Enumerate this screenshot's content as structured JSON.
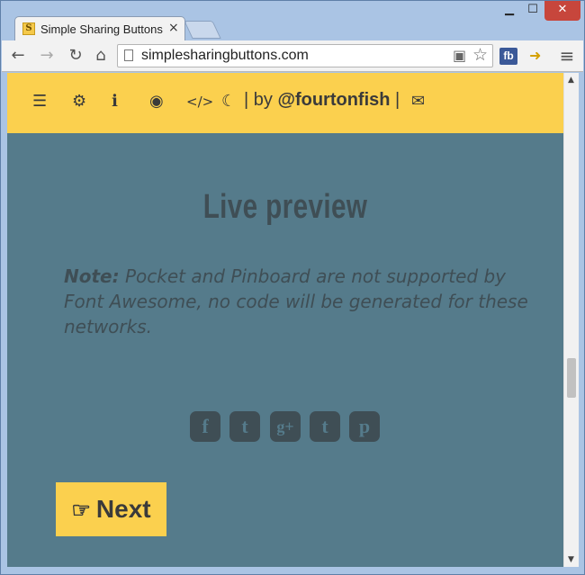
{
  "browser": {
    "tab": {
      "title": "Simple Sharing Buttons G",
      "favicon": "S",
      "close": "×"
    },
    "window_controls": {
      "minimize": "▁",
      "maximize": "☐",
      "close": "✕"
    },
    "toolbar": {
      "back": "←",
      "forward": "→",
      "reload": "↻",
      "home": "⌂",
      "menu": "≡"
    },
    "omnibox": {
      "url": "simplesharingbuttons.com",
      "translate_icon": "▣",
      "star_icon": "☆"
    },
    "extension": {
      "fb_label": "fb",
      "ext2": "➜"
    }
  },
  "site_nav": {
    "icons": [
      "list-icon",
      "gear-icon",
      "info-icon",
      "eye-icon",
      "code-icon",
      "moon-icon",
      "envelope-icon"
    ],
    "glyphs": {
      "list": "☰",
      "gear": "⚙",
      "info": "ℹ",
      "eye": "◉",
      "code": "</>",
      "moon": "☾",
      "envelope": "✉"
    },
    "separator": "|",
    "by_text": "by",
    "author": "@fourtonfish"
  },
  "main": {
    "heading": "Live preview",
    "note_label": "Note:",
    "note_text": "Pocket and Pinboard are not supported by Font Awesome, no code will be generated for these networks."
  },
  "social": [
    {
      "name": "facebook-icon",
      "glyph": "f"
    },
    {
      "name": "twitter-icon",
      "glyph": "t"
    },
    {
      "name": "google-plus-icon",
      "glyph": "g+"
    },
    {
      "name": "tumblr-icon",
      "glyph": "t"
    },
    {
      "name": "pinterest-icon",
      "glyph": "p"
    }
  ],
  "next_button": {
    "icon": "☞",
    "label": "Next"
  },
  "colors": {
    "nav_yellow": "#fbd04e",
    "content_bg": "#557b8b",
    "text_dark": "#3f4e55"
  }
}
